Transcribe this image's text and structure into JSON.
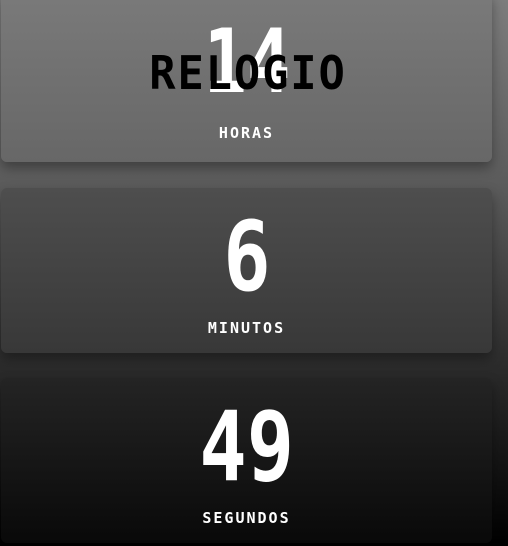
{
  "title": "RELOGIO",
  "clock": {
    "hours": {
      "value": "14",
      "label": "HORAS"
    },
    "minutes": {
      "value": "6",
      "label": "MINUTOS"
    },
    "seconds": {
      "value": "49",
      "label": "SEGUNDOS"
    }
  },
  "colors": {
    "digit": "#ffffff",
    "title": "#000000",
    "background_top": "#7d7d7d",
    "background_bottom": "#000000"
  }
}
